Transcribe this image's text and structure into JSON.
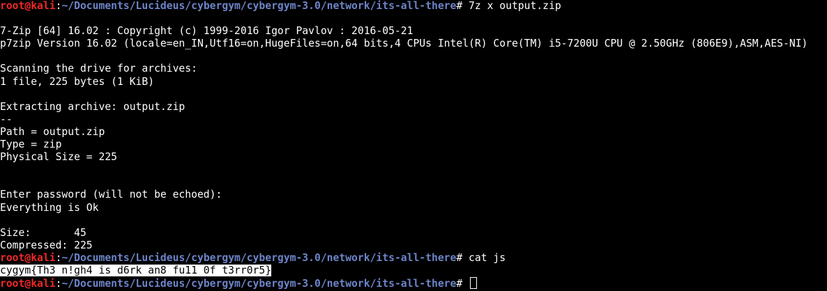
{
  "colors": {
    "background": "#000000",
    "user": "#ef2929",
    "path": "#6d84c8",
    "text": "#ffffff"
  },
  "prompt": {
    "user": "root@kali",
    "colon": ":",
    "path": "~/Documents/Lucideus/cybergym/cybergym-3.0/network/its-all-there",
    "symbol": "#"
  },
  "commands": {
    "first": " 7z x output.zip",
    "second": " cat js",
    "third": " "
  },
  "output": {
    "blank1": "",
    "l1": "7-Zip [64] 16.02 : Copyright (c) 1999-2016 Igor Pavlov : 2016-05-21",
    "l2": "p7zip Version 16.02 (locale=en_IN,Utf16=on,HugeFiles=on,64 bits,4 CPUs Intel(R) Core(TM) i5-7200U CPU @ 2.50GHz (806E9),ASM,AES-NI)",
    "blank2": "",
    "l3": "Scanning the drive for archives:",
    "l4": "1 file, 225 bytes (1 KiB)",
    "blank3": "",
    "l5": "Extracting archive: output.zip",
    "l6": "--",
    "l7": "Path = output.zip",
    "l8": "Type = zip",
    "l9": "Physical Size = 225",
    "blank4": "",
    "blank5": "",
    "l10": "Enter password (will not be echoed):",
    "l11": "Everything is Ok",
    "blank6": "",
    "l12": "Size:       45",
    "l13": "Compressed: 225",
    "flag": "cygym{Th3 n!gh4 is d6rk an8 fu11 0f t3rr0r5}"
  }
}
